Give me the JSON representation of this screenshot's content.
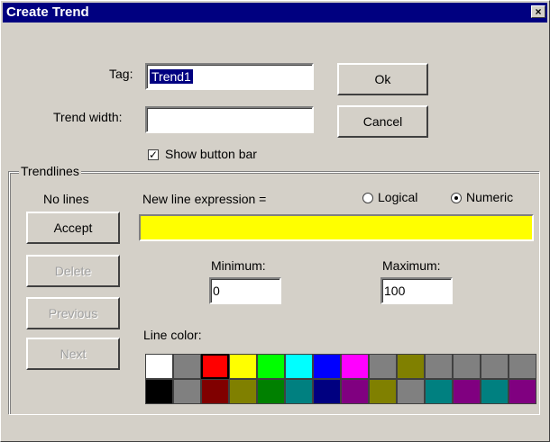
{
  "window": {
    "title": "Create Trend",
    "close_symbol": "×"
  },
  "tag": {
    "label": "Tag:",
    "value": "Trend1"
  },
  "trend_width": {
    "label": "Trend width:",
    "value": ""
  },
  "buttons": {
    "ok": "Ok",
    "cancel": "Cancel"
  },
  "show_button_bar": {
    "label": "Show button bar",
    "checked": true
  },
  "trendlines": {
    "title": "Trendlines",
    "status": "No lines",
    "accept": "Accept",
    "delete": "Delete",
    "previous": "Previous",
    "next": "Next",
    "expression_label": "New line expression =",
    "expression_value": "",
    "expression_color": "#ffff00",
    "radio_logical": "Logical",
    "radio_numeric": "Numeric",
    "selected_type": "Numeric",
    "minimum_label": "Minimum:",
    "minimum_value": "0",
    "maximum_label": "Maximum:",
    "maximum_value": "100",
    "line_color_label": "Line color:",
    "palette_row1": [
      "#ffffff",
      "#808080",
      "#ff0000",
      "#ffff00",
      "#00ff00",
      "#00ffff",
      "#0000ff",
      "#ff00ff",
      "#808080",
      "#808000",
      "#808080",
      "#808080",
      "#808080",
      "#808080"
    ],
    "palette_row2": [
      "#000000",
      "#808080",
      "#800000",
      "#808000",
      "#008000",
      "#008080",
      "#000080",
      "#800080",
      "#808000",
      "#808080",
      "#008080",
      "#800080",
      "#008080",
      "#800080"
    ],
    "selected_color_index": 2
  }
}
